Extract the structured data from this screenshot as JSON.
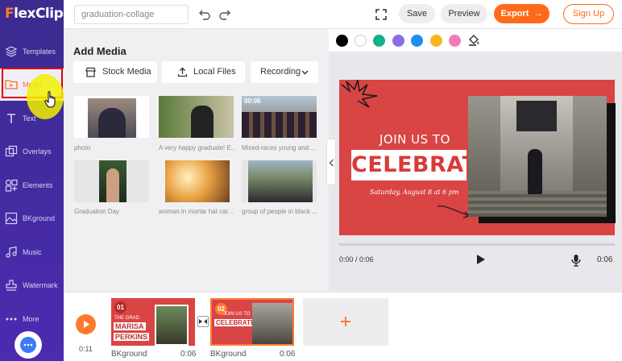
{
  "app": {
    "logo_prefix": "F",
    "logo_suffix": "lexClip"
  },
  "sidebar": {
    "items": [
      {
        "label": "Templates",
        "icon": "layers-icon"
      },
      {
        "label": "Media",
        "icon": "media-folder-icon"
      },
      {
        "label": "Text",
        "icon": "text-icon"
      },
      {
        "label": "Overlays",
        "icon": "overlays-icon"
      },
      {
        "label": "Elements",
        "icon": "elements-icon"
      },
      {
        "label": "BKground",
        "icon": "background-icon"
      },
      {
        "label": "Music",
        "icon": "music-icon"
      },
      {
        "label": "Watermark",
        "icon": "watermark-icon"
      },
      {
        "label": "More",
        "icon": "more-icon"
      }
    ]
  },
  "topbar": {
    "project_name": "graduation-collage",
    "save_label": "Save",
    "preview_label": "Preview",
    "export_label": "Export",
    "signup_label": "Sign Up"
  },
  "media_panel": {
    "title": "Add Media",
    "sources": [
      "Stock Media",
      "Local Files",
      "Recording"
    ],
    "items": [
      {
        "caption": "photo"
      },
      {
        "caption": "A very happy graduate! E..."
      },
      {
        "caption": "Mixed-races young and ...",
        "badge": "00:06"
      },
      {
        "caption": "Graduation Day"
      },
      {
        "caption": "woman in mortar hat car..."
      },
      {
        "caption": "group of people in black ..."
      }
    ]
  },
  "colors": {
    "accent": "#ff6a1a",
    "sidebar": "#4b2bb0",
    "slide_red": "#d94444",
    "swatches": [
      "#000000",
      "#ffffff",
      "#12b08a",
      "#8a6be8",
      "#1f8ef0",
      "#f7b71c",
      "#f27bb5"
    ]
  },
  "slide": {
    "heading": "JOIN US TO",
    "title": "CELEBRATE",
    "date": "Saturday, August 8 at 6 pm"
  },
  "player": {
    "current": "0:00 / 0:06",
    "duration": "0:06"
  },
  "timeline": {
    "time": "0:11",
    "clips": [
      {
        "number": "01",
        "label": "BKground",
        "duration": "0:06",
        "lines": [
          "THE GRAD",
          "MARISA",
          "PERKINS"
        ]
      },
      {
        "number": "02",
        "label": "BKground",
        "duration": "0:06",
        "lines": [
          "JOIN US TO",
          "CELEBRATE"
        ]
      }
    ]
  }
}
